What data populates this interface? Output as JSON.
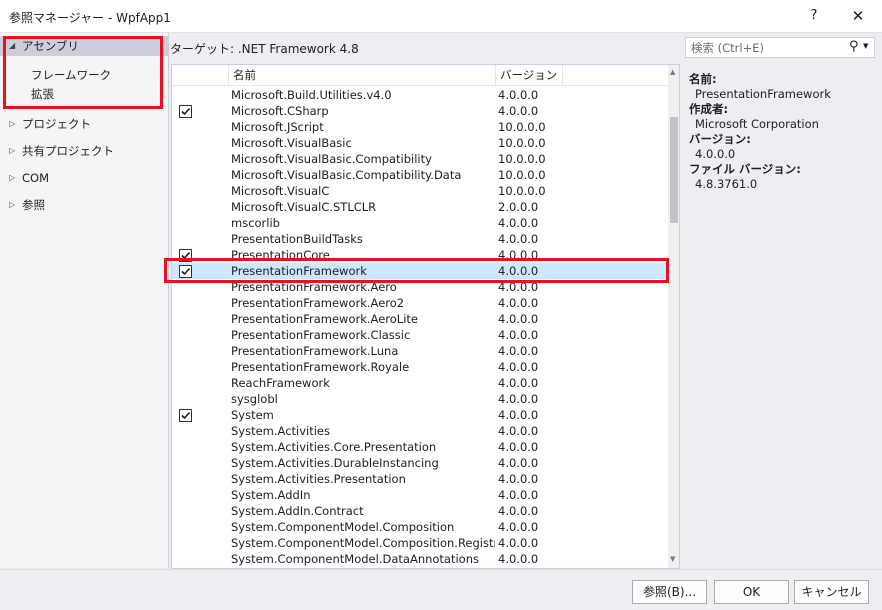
{
  "window": {
    "title": "参照マネージャー - WpfApp1",
    "help_label": "?",
    "close_label": "✕"
  },
  "left_nav": {
    "items": [
      {
        "label": "アセンブリ",
        "arrow": "◢",
        "selected": true
      },
      {
        "label": "プロジェクト",
        "arrow": "▷"
      },
      {
        "label": "共有プロジェクト",
        "arrow": "▷"
      },
      {
        "label": "COM",
        "arrow": "▷"
      },
      {
        "label": "参照",
        "arrow": "▷"
      }
    ],
    "subitems": [
      {
        "label": "フレームワーク"
      },
      {
        "label": "拡張"
      }
    ]
  },
  "target_label": "ターゲット: .NET Framework 4.8",
  "search": {
    "placeholder": "検索 (Ctrl+E)",
    "icon": "search-icon"
  },
  "list": {
    "columns": {
      "name": "名前",
      "version": "バージョン"
    },
    "rows": [
      {
        "name": "Microsoft.Build.Utilities.v4.0",
        "version": "4.0.0.0",
        "checked": false
      },
      {
        "name": "Microsoft.CSharp",
        "version": "4.0.0.0",
        "checked": true
      },
      {
        "name": "Microsoft.JScript",
        "version": "10.0.0.0",
        "checked": false
      },
      {
        "name": "Microsoft.VisualBasic",
        "version": "10.0.0.0",
        "checked": false
      },
      {
        "name": "Microsoft.VisualBasic.Compatibility",
        "version": "10.0.0.0",
        "checked": false
      },
      {
        "name": "Microsoft.VisualBasic.Compatibility.Data",
        "version": "10.0.0.0",
        "checked": false
      },
      {
        "name": "Microsoft.VisualC",
        "version": "10.0.0.0",
        "checked": false
      },
      {
        "name": "Microsoft.VisualC.STLCLR",
        "version": "2.0.0.0",
        "checked": false
      },
      {
        "name": "mscorlib",
        "version": "4.0.0.0",
        "checked": false
      },
      {
        "name": "PresentationBuildTasks",
        "version": "4.0.0.0",
        "checked": false
      },
      {
        "name": "PresentationCore",
        "version": "4.0.0.0",
        "checked": true
      },
      {
        "name": "PresentationFramework",
        "version": "4.0.0.0",
        "checked": true,
        "selected": true
      },
      {
        "name": "PresentationFramework.Aero",
        "version": "4.0.0.0",
        "checked": false
      },
      {
        "name": "PresentationFramework.Aero2",
        "version": "4.0.0.0",
        "checked": false
      },
      {
        "name": "PresentationFramework.AeroLite",
        "version": "4.0.0.0",
        "checked": false
      },
      {
        "name": "PresentationFramework.Classic",
        "version": "4.0.0.0",
        "checked": false
      },
      {
        "name": "PresentationFramework.Luna",
        "version": "4.0.0.0",
        "checked": false
      },
      {
        "name": "PresentationFramework.Royale",
        "version": "4.0.0.0",
        "checked": false
      },
      {
        "name": "ReachFramework",
        "version": "4.0.0.0",
        "checked": false
      },
      {
        "name": "sysglobl",
        "version": "4.0.0.0",
        "checked": false
      },
      {
        "name": "System",
        "version": "4.0.0.0",
        "checked": true
      },
      {
        "name": "System.Activities",
        "version": "4.0.0.0",
        "checked": false
      },
      {
        "name": "System.Activities.Core.Presentation",
        "version": "4.0.0.0",
        "checked": false
      },
      {
        "name": "System.Activities.DurableInstancing",
        "version": "4.0.0.0",
        "checked": false
      },
      {
        "name": "System.Activities.Presentation",
        "version": "4.0.0.0",
        "checked": false
      },
      {
        "name": "System.AddIn",
        "version": "4.0.0.0",
        "checked": false
      },
      {
        "name": "System.AddIn.Contract",
        "version": "4.0.0.0",
        "checked": false
      },
      {
        "name": "System.ComponentModel.Composition",
        "version": "4.0.0.0",
        "checked": false
      },
      {
        "name": "System.ComponentModel.Composition.Registr...",
        "version": "4.0.0.0",
        "checked": false
      },
      {
        "name": "System.ComponentModel.DataAnnotations",
        "version": "4.0.0.0",
        "checked": false
      }
    ]
  },
  "details": {
    "name_label": "名前:",
    "name_value": "PresentationFramework",
    "author_label": "作成者:",
    "author_value": "Microsoft Corporation",
    "version_label": "バージョン:",
    "version_value": "4.0.0.0",
    "file_version_label": "ファイル バージョン:",
    "file_version_value": "4.8.3761.0"
  },
  "footer": {
    "browse_label": "参照(B)...",
    "ok_label": "OK",
    "cancel_label": "キャンセル"
  },
  "colors": {
    "highlight": "#e81123",
    "selected_row": "#cce8ff",
    "nav_selected": "#cccedb"
  }
}
